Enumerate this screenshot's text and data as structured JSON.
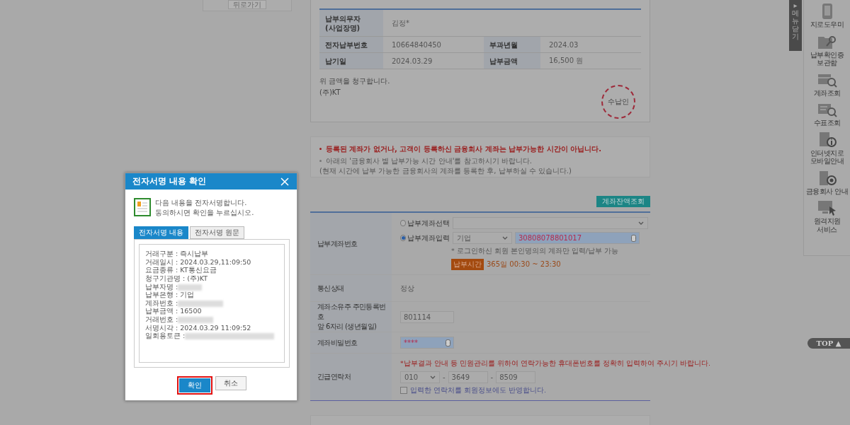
{
  "left_panel": {
    "button": "뒤로가기"
  },
  "bill": {
    "rows": [
      [
        {
          "label": "납부의무자\n(사업장명)",
          "value": "김정*"
        }
      ],
      [
        {
          "label": "전자납부번호",
          "value": "10664840450"
        },
        {
          "label": "부과년월",
          "value": "2024.03"
        }
      ],
      [
        {
          "label": "납기일",
          "value": "2024.03.29"
        },
        {
          "label": "납부금액",
          "value": "16,500 원"
        }
      ]
    ],
    "claim": "위 금액을 청구합니다.",
    "issuer": "(주)KT",
    "stamp": "수납인"
  },
  "notices": [
    {
      "text": "등록된 계좌가 없거나, 고객이 등록하신 금융회사 계좌는 납부가능한 시간이 아닙니다.",
      "kind": "warning"
    },
    {
      "text": "아래의 '금융회사 별 납부가능 시간 안내'를 참고하시기 바랍니다.\n(현재 시간에 납부 가능한 금융회사의 계좌를 등록한 후, 납부하실 수 있습니다.)",
      "kind": "info"
    }
  ],
  "balance_button": "계좌잔액조회",
  "form": {
    "account_label": "납부계좌번호",
    "options": [
      {
        "label": "납부계좌선택",
        "selected": false
      },
      {
        "label": "납부계좌입력",
        "selected": true
      }
    ],
    "bank": "기업",
    "account_number": "30808078801017",
    "hint": "* 로그인하신 회원 본인명의의 계좌만 입력/납부 가능",
    "time_badge": "납부시간",
    "time": "365일 00:30 ~ 23:30",
    "status_label": "통신상태",
    "status": "정상",
    "id_label": "계좌소유주 주민등록번호\n앞 6자리 (생년월일)",
    "id_value": "801114",
    "password_label": "계좌비밀번호",
    "password": "****",
    "contact_label": "긴급연락처",
    "contact_notice": "*납부결과 안내 등 민원관리를 위하여 연락가능한 휴대폰번호를 정확히 입력하여 주시기 바랍니다.",
    "phone": [
      "010",
      "3649",
      "8509"
    ],
    "phone_separator": "-",
    "save_contact": {
      "label": "입력한 연락처를 회원정보에도 반영합니다.",
      "checked": false
    }
  },
  "sidebar": {
    "close_tab": "▸ 메뉴닫기",
    "items": [
      {
        "label": "지로도우미",
        "kind": "tablet"
      },
      {
        "label": "납부확인증\n보관함",
        "kind": "folder"
      },
      {
        "label": "계좌조회",
        "kind": "card-search"
      },
      {
        "label": "수표조회",
        "kind": "doc-search"
      },
      {
        "label": "인터넷지로\n모바일안내",
        "kind": "info"
      },
      {
        "label": "금융회사 안내",
        "kind": "bank"
      },
      {
        "label": "원격지원\n서비스",
        "kind": "remote"
      }
    ],
    "top_button": "TOP ▲"
  },
  "dialog": {
    "title": "전자서명 내용 확인",
    "message": "다음 내용을 전자서명합니다.\n동의하시면 확인을 누르십시오.",
    "tabs": [
      {
        "label": "전자서명 내용",
        "selected": true
      },
      {
        "label": "전자서명 원문",
        "selected": false
      }
    ],
    "lines": [
      {
        "label": "거래구분 : ",
        "value": "즉시납부"
      },
      {
        "label": "거래일시 : ",
        "value": "2024.03.29,11:09:50"
      },
      {
        "label": "요금종류 : ",
        "value": "KT통신요금"
      },
      {
        "label": "청구기관명 : ",
        "value": "(주)KT"
      },
      {
        "label": "납부자명 : ",
        "redacted": true
      },
      {
        "label": "납부은행 : ",
        "value": "기업"
      },
      {
        "label": "계좌번호 : ",
        "redacted": true
      },
      {
        "label": "납부금액 : ",
        "value": "16500"
      },
      {
        "label": "거래번호 : ",
        "redacted": true
      },
      {
        "label": "서명시각 : ",
        "value": "2024.03.29 11:09:52"
      },
      {
        "label": "일회용토큰 : ",
        "redacted": true
      }
    ],
    "buttons": [
      {
        "label": "확인",
        "primary": true,
        "highlighted": true
      },
      {
        "label": "취소",
        "primary": false,
        "highlighted": false
      }
    ]
  }
}
